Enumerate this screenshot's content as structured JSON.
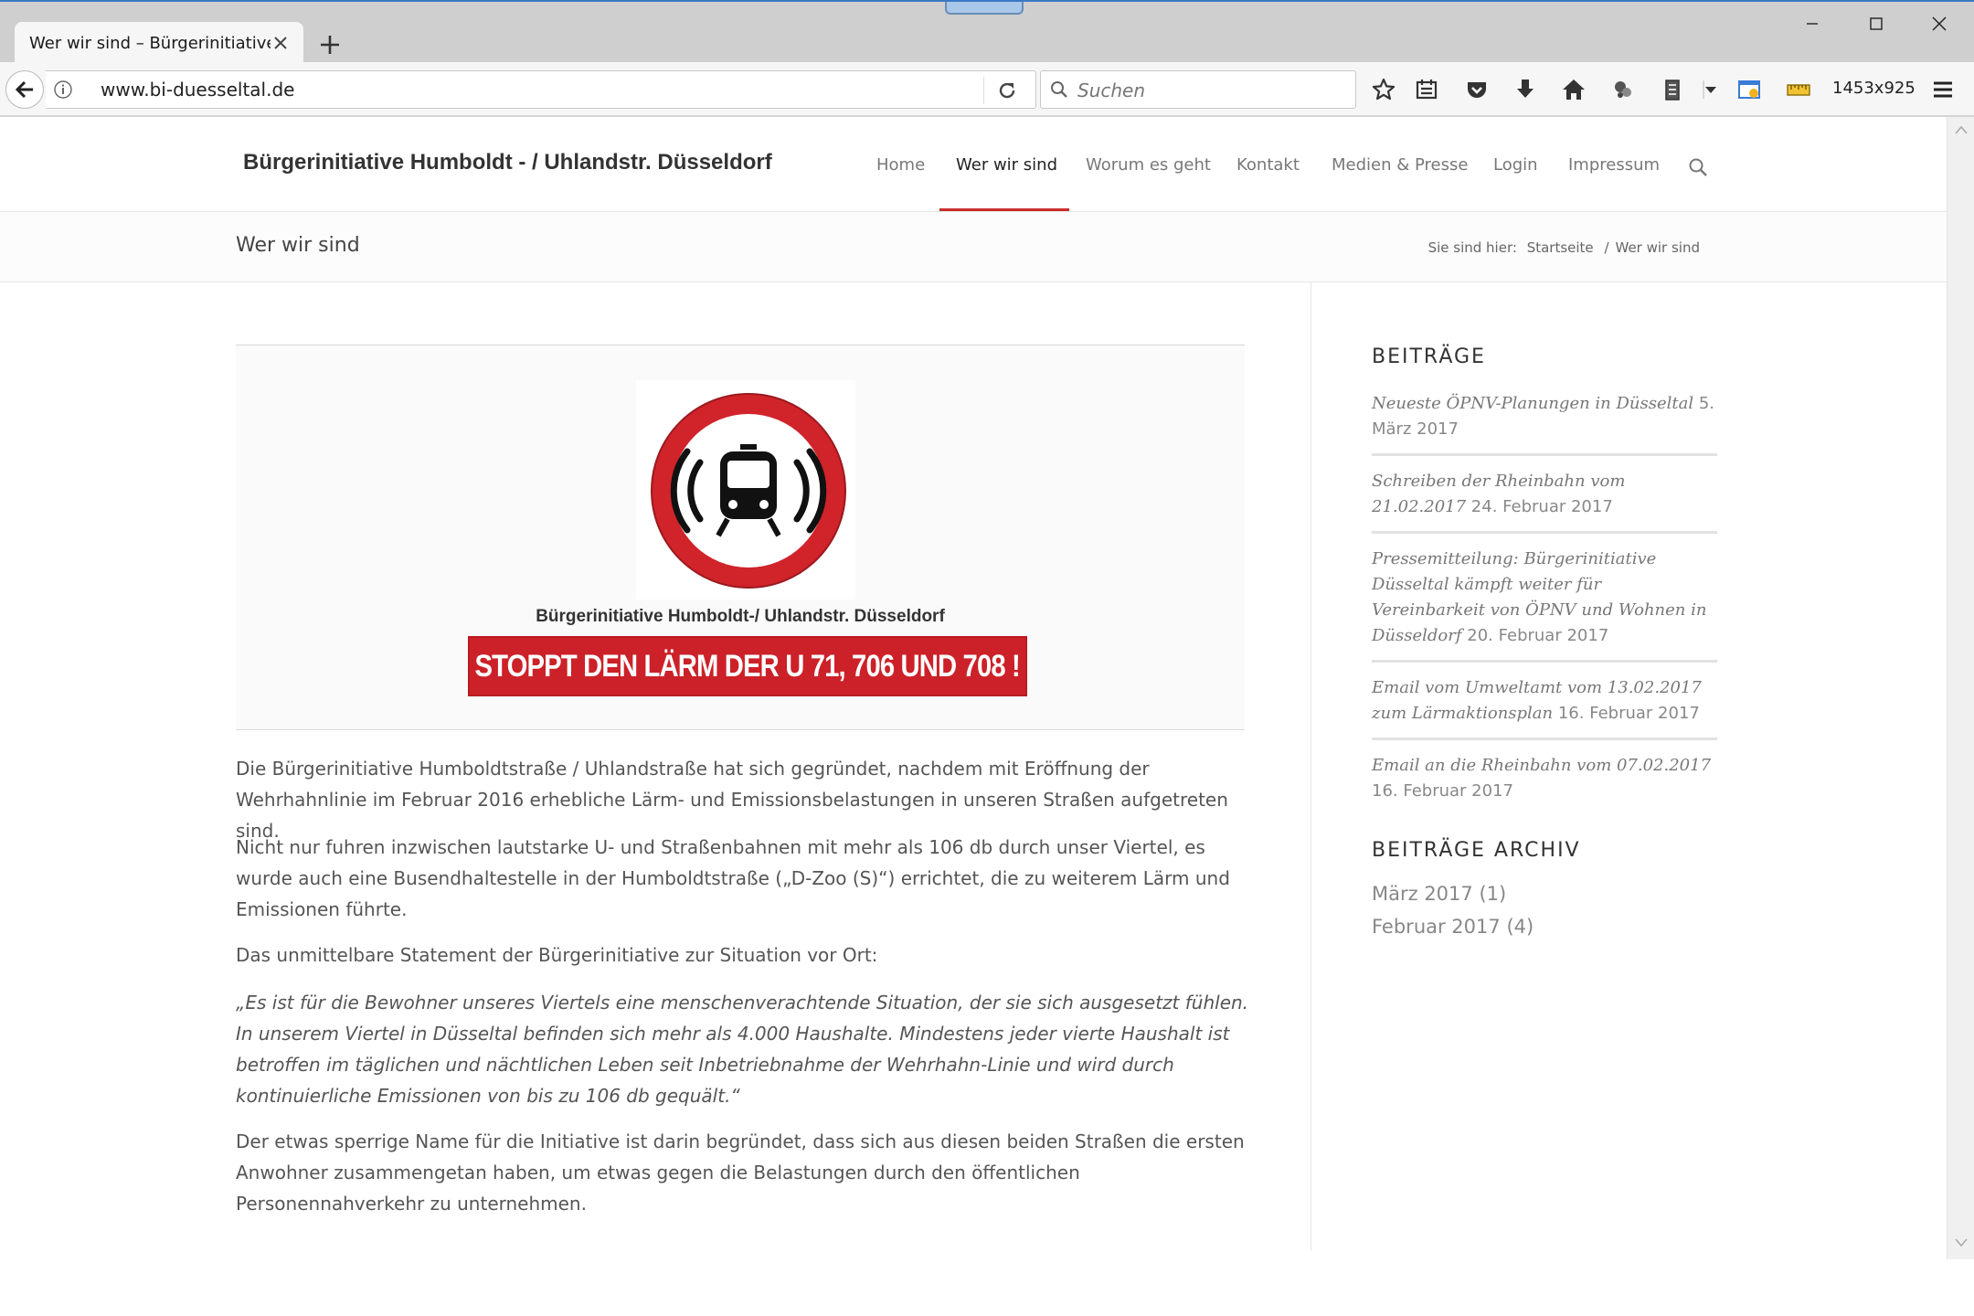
{
  "browser": {
    "tab_title": "Wer wir sind – Bürgerinitiative...",
    "url": "www.bi-duesseltal.de",
    "search_placeholder": "Suchen",
    "resolution": "1453x925"
  },
  "site": {
    "title": "Bürgerinitiative Humboldt - / Uhlandstr. Düsseldorf",
    "nav": [
      {
        "label": "Home"
      },
      {
        "label": "Wer wir sind",
        "active": true
      },
      {
        "label": "Worum es geht"
      },
      {
        "label": "Kontakt"
      },
      {
        "label": "Medien & Presse"
      },
      {
        "label": "Login"
      },
      {
        "label": "Impressum"
      }
    ]
  },
  "page": {
    "title": "Wer wir sind",
    "breadcrumb": {
      "prefix": "Sie sind hier:",
      "home": "Startseite",
      "separator": "/",
      "current": "Wer wir sind"
    },
    "banner": {
      "caption": "Bürgerinitiative Humboldt-/ Uhlandstr. Düsseldorf",
      "slogan": "STOPPT DEN LÄRM DER U 71, 706 UND 708 !",
      "red": "#cc2128"
    },
    "paragraphs": [
      "Die Bürgerinitiative Humboldtstraße / Uhlandstraße hat sich gegründet, nachdem mit Eröffnung der Wehrhahnlinie im Februar 2016 erhebliche Lärm- und Emissionsbelastungen in unseren Straßen aufgetreten sind.",
      "Nicht nur fuhren inzwischen lautstarke U- und Straßenbahnen mit mehr als 106 db durch unser Viertel, es wurde auch eine Busendhaltestelle in der Humboldtstraße („D-Zoo (S)“) errichtet, die zu weiterem Lärm und Emissionen führte.",
      "Das unmittelbare Statement der Bürgerinitiative zur Situation vor Ort:",
      "„Es ist für die Bewohner unseres Viertels eine menschenverachtende Situation, der sie sich ausgesetzt fühlen. In unserem Viertel in Düsseltal befinden sich mehr als 4.000 Haushalte. Mindestens jeder vierte Haushalt ist betroffen im täglichen und nächtlichen Leben seit Inbetriebnahme der Wehrhahn-Linie und wird durch kontinuierliche Emissionen von bis zu 106 db gequält.“",
      "Der etwas sperrige Name für die Initiative ist darin begründet, dass sich aus diesen beiden Straßen die ersten Anwohner zusammengetan haben, um etwas gegen die Belastungen durch den öffentlichen Personennahverkehr zu unternehmen."
    ]
  },
  "sidebar": {
    "posts_title": "BEITRÄGE",
    "posts": [
      {
        "title": "Neueste ÖPNV-Planungen in Düsseltal",
        "date": "5. März 2017"
      },
      {
        "title": "Schreiben der Rheinbahn vom 21.02.2017",
        "date": "24. Februar 2017"
      },
      {
        "title": "Pressemitteilung: Bürgerinitiative Düsseltal kämpft weiter für Vereinbarkeit von ÖPNV und Wohnen in Düsseldorf",
        "date": "20. Februar 2017"
      },
      {
        "title": "Email vom Umweltamt vom 13.02.2017 zum Lärmaktionsplan",
        "date": "16. Februar 2017"
      },
      {
        "title": "Email an die Rheinbahn vom 07.02.2017",
        "date": "16. Februar 2017"
      }
    ],
    "archive_title": "BEITRÄGE ARCHIV",
    "archive": [
      {
        "label": "März 2017",
        "count": "(1)"
      },
      {
        "label": "Februar 2017",
        "count": "(4)"
      }
    ]
  },
  "colors": {
    "accent": "#cc2c2c",
    "nav_inactive": "#777777",
    "text": "#555555"
  }
}
